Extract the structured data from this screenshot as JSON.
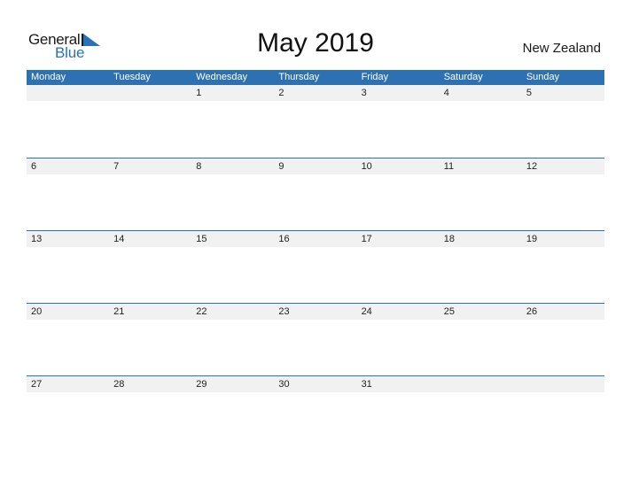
{
  "brand": {
    "word1": "General",
    "word2": "Blue",
    "accent_color": "#2a72b8"
  },
  "header": {
    "title": "May 2019",
    "country": "New Zealand"
  },
  "calendar": {
    "header_color": "#2e71b2",
    "weekdays": [
      "Monday",
      "Tuesday",
      "Wednesday",
      "Thursday",
      "Friday",
      "Saturday",
      "Sunday"
    ],
    "weeks": [
      [
        "",
        "",
        "1",
        "2",
        "3",
        "4",
        "5"
      ],
      [
        "6",
        "7",
        "8",
        "9",
        "10",
        "11",
        "12"
      ],
      [
        "13",
        "14",
        "15",
        "16",
        "17",
        "18",
        "19"
      ],
      [
        "20",
        "21",
        "22",
        "23",
        "24",
        "25",
        "26"
      ],
      [
        "27",
        "28",
        "29",
        "30",
        "31",
        "",
        ""
      ]
    ]
  }
}
